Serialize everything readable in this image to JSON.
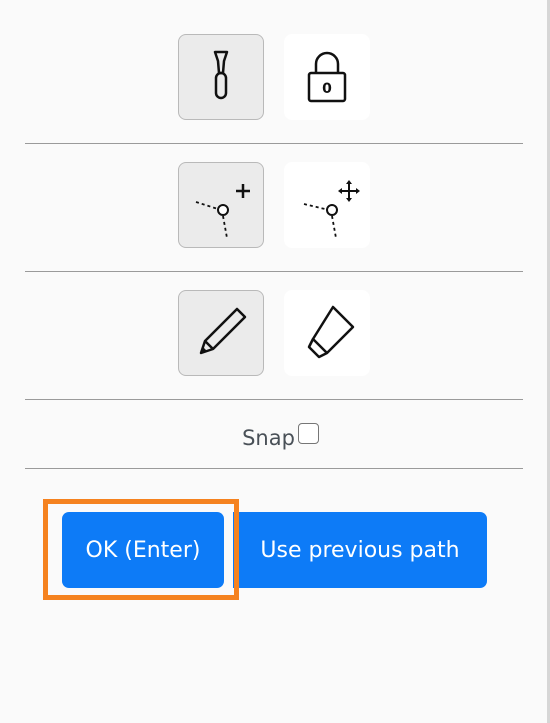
{
  "toolbar": {
    "rows": [
      {
        "buttons": [
          {
            "icon": "screwdriver-icon",
            "state": "active"
          },
          {
            "icon": "lock-icon",
            "state": "inactive",
            "glyph": "0"
          }
        ]
      },
      {
        "buttons": [
          {
            "icon": "add-vertex-icon",
            "state": "active"
          },
          {
            "icon": "move-vertex-icon",
            "state": "inactive"
          }
        ]
      },
      {
        "buttons": [
          {
            "icon": "pencil-icon",
            "state": "active"
          },
          {
            "icon": "eraser-icon",
            "state": "inactive"
          }
        ]
      }
    ]
  },
  "snap": {
    "label": "Snap",
    "checked": false
  },
  "actions": {
    "ok_label": "OK (Enter)",
    "previous_path_label": "Use previous path"
  },
  "colors": {
    "primary_button": "#0d7bf7",
    "highlight": "#f5821f",
    "active_tool_bg": "#ebebeb",
    "background": "#fafafa"
  }
}
